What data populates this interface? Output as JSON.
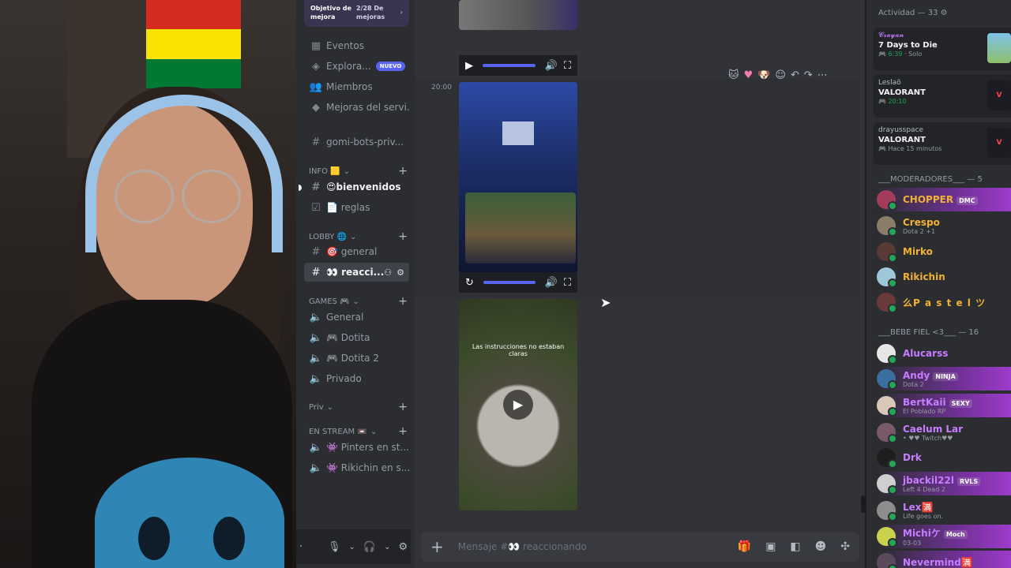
{
  "sidebar": {
    "boost_left": "Objetivo de mejora",
    "boost_right": "2/28 De mejoras",
    "top_items": [
      {
        "icon": "calendar-icon",
        "label": "Eventos"
      },
      {
        "icon": "compass-icon",
        "label": "Explora...",
        "badge": "NUEVO"
      },
      {
        "icon": "members-icon",
        "label": "Miembros"
      },
      {
        "icon": "boost-icon",
        "label": "Mejoras del servi..."
      }
    ],
    "pinned_channel": "gomi-bots-priv...",
    "categories": [
      {
        "label": "INFO 🟨",
        "channels": [
          {
            "name": "😍bienvenidos"
          },
          {
            "name": "📄 reglas"
          }
        ]
      },
      {
        "label": "LOBBY 🌐",
        "channels": [
          {
            "name": "🎯 general"
          },
          {
            "name": "👀 reacci..."
          }
        ]
      },
      {
        "label": "GAMES 🎮",
        "channels": [
          {
            "name": "General"
          },
          {
            "name": "🎮 Dotita"
          },
          {
            "name": "🎮 Dotita 2"
          },
          {
            "name": "Privado"
          }
        ]
      },
      {
        "label": "Priv",
        "channels": []
      },
      {
        "label": "EN STREAM 📼",
        "channels": [
          {
            "name": "👾 Pinters en st..."
          },
          {
            "name": "👾 Rikichin en s..."
          }
        ]
      }
    ]
  },
  "chat": {
    "timestamp": "20:00",
    "video_caption": "Las instrucciones no estaban claras",
    "composer_placeholder": "Mensaje #👀 reaccionando"
  },
  "members": {
    "activity_title": "Actividad — 33",
    "activities": [
      {
        "user": "𝓒𝓻𝓪𝔂𝓪𝓷",
        "game": "7 Days to Die",
        "time": "6:39",
        "extra": "· Solo"
      },
      {
        "user": "Leslaö",
        "game": "VALORANT",
        "time": "20:10",
        "extra": ""
      },
      {
        "user": "drayusspace",
        "game": "VALORANT",
        "time": "Hace 15 minutos",
        "extra": ""
      }
    ],
    "moderators_title": "___MODERADORES___ — 5",
    "moderators": [
      {
        "name": "CHOPPER",
        "tag": "DMC",
        "status": "",
        "color": "#f0b232"
      },
      {
        "name": "Crespo",
        "tag": "",
        "status": "Dota 2 +1",
        "color": "#f0b232"
      },
      {
        "name": "Mirko",
        "tag": "",
        "status": "",
        "color": "#f0b232"
      },
      {
        "name": "Rikichin",
        "tag": "",
        "status": "",
        "color": "#f0b232"
      },
      {
        "name": "么P a s t e l ツ",
        "tag": "",
        "status": "",
        "color": "#f0b232"
      }
    ],
    "fans_title": "___BEBE FIEL <3___ — 16",
    "fans": [
      {
        "name": "Alucarss",
        "tag": "",
        "status": "",
        "color": "#c77dff"
      },
      {
        "name": "Andy",
        "tag": "NINJA",
        "status": "Dota 2",
        "color": "#c77dff"
      },
      {
        "name": "BertKaii",
        "tag": "SEXY",
        "status": "El Poblado RP",
        "color": "#c77dff"
      },
      {
        "name": "Caelum Lar",
        "tag": "",
        "status": "• ♥♥ Twitch♥♥",
        "color": "#c77dff"
      },
      {
        "name": "Drk",
        "tag": "",
        "status": "",
        "color": "#c77dff"
      },
      {
        "name": "jbackil22l",
        "tag": "RVLS",
        "status": "Left 4 Dead 2",
        "color": "#c77dff"
      },
      {
        "name": "Lex🈵",
        "tag": "",
        "status": "Life goes on.",
        "color": "#c77dff"
      },
      {
        "name": "Michiケ",
        "tag": "Moch",
        "status": "03-03",
        "color": "#c77dff"
      },
      {
        "name": "Nevermind🈵",
        "tag": "",
        "status": "",
        "color": "#c77dff"
      }
    ]
  }
}
